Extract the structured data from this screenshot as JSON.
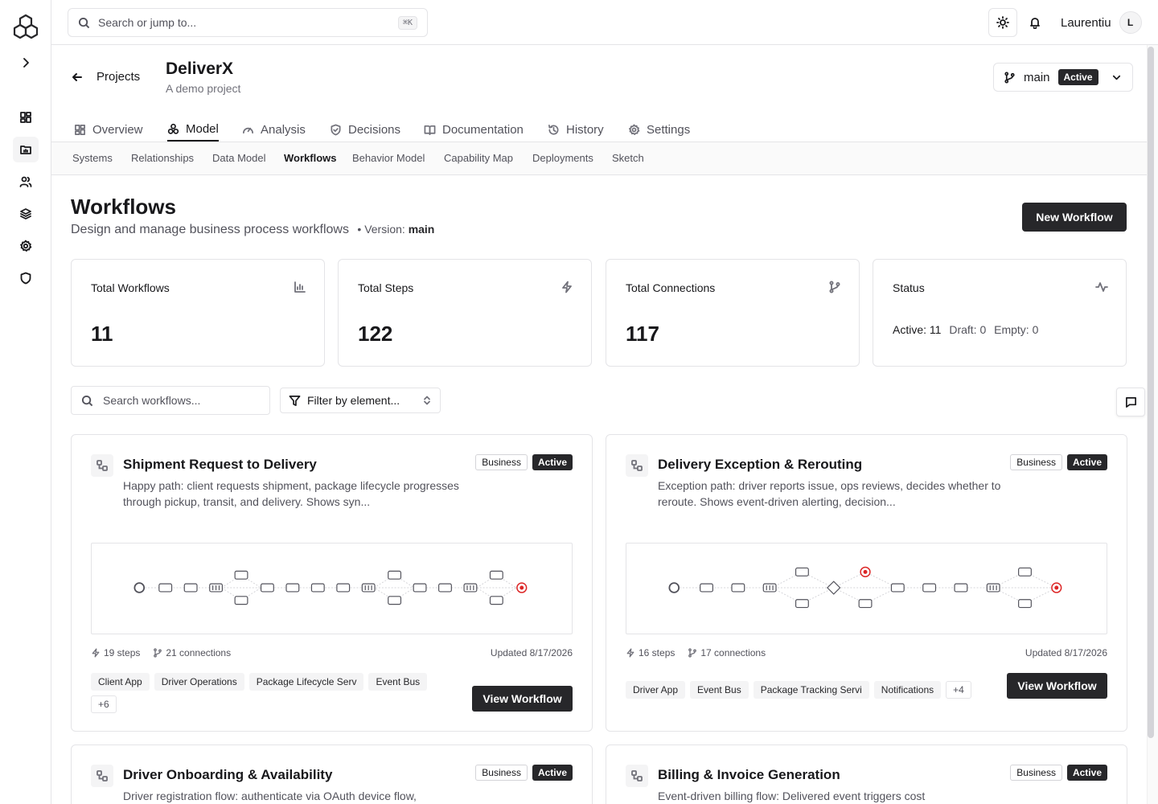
{
  "search": {
    "placeholder": "Search or jump to...",
    "shortcut": "⌘K"
  },
  "user": {
    "name": "Laurentiu",
    "initial": "L"
  },
  "project": {
    "back_label": "Projects",
    "name": "DeliverX",
    "description": "A demo project"
  },
  "branch": {
    "name": "main",
    "status": "Active"
  },
  "tabs": [
    {
      "label": "Overview",
      "icon": "grid-icon"
    },
    {
      "label": "Model",
      "icon": "model-icon",
      "active": true
    },
    {
      "label": "Analysis",
      "icon": "gauge-icon"
    },
    {
      "label": "Decisions",
      "icon": "shield-check-icon"
    },
    {
      "label": "Documentation",
      "icon": "book-icon"
    },
    {
      "label": "History",
      "icon": "history-icon"
    },
    {
      "label": "Settings",
      "icon": "gear-icon"
    }
  ],
  "subtabs": [
    {
      "label": "Systems"
    },
    {
      "label": "Relationships"
    },
    {
      "label": "Data Model"
    },
    {
      "label": "Workflows",
      "active": true
    },
    {
      "label": "Behavior Model"
    },
    {
      "label": "Capability Map"
    },
    {
      "label": "Deployments"
    },
    {
      "label": "Sketch"
    }
  ],
  "page": {
    "title": "Workflows",
    "subtitle": "Design and manage business process workflows",
    "version_prefix": "• Version:",
    "version": "main",
    "new_button": "New Workflow"
  },
  "stats": [
    {
      "label": "Total Workflows",
      "value": "11",
      "icon": "bar-chart-icon"
    },
    {
      "label": "Total Steps",
      "value": "122",
      "icon": "zap-icon"
    },
    {
      "label": "Total Connections",
      "value": "117",
      "icon": "git-branch-icon"
    },
    {
      "label": "Status",
      "icon": "activity-icon",
      "active": "Active: 11",
      "draft": "Draft: 0",
      "empty": "Empty: 0"
    }
  ],
  "filters": {
    "search_placeholder": "Search workflows...",
    "filter_label": "Filter by element..."
  },
  "workflows": [
    {
      "title": "Shipment Request to Delivery",
      "description": "Happy path: client requests shipment, package lifecycle progresses through pickup, transit, and delivery. Shows syn...",
      "type_badge": "Business",
      "status_badge": "Active",
      "steps": "19 steps",
      "connections": "21 connections",
      "updated": "Updated 8/17/2026",
      "chips": [
        "Client App",
        "Driver Operations",
        "Package Lifecycle Serv",
        "Event Bus"
      ],
      "more": "+6",
      "view_label": "View Workflow"
    },
    {
      "title": "Delivery Exception & Rerouting",
      "description": "Exception path: driver reports issue, ops reviews, decides whether to reroute. Shows event-driven alerting, decision...",
      "type_badge": "Business",
      "status_badge": "Active",
      "steps": "16 steps",
      "connections": "17 connections",
      "updated": "Updated 8/17/2026",
      "chips": [
        "Driver App",
        "Event Bus",
        "Package Tracking Servi",
        "Notifications"
      ],
      "more": "+4",
      "view_label": "View Workflow"
    },
    {
      "title": "Driver Onboarding & Availability",
      "description": "Driver registration flow: authenticate via OAuth device flow,",
      "type_badge": "Business",
      "status_badge": "Active"
    },
    {
      "title": "Billing & Invoice Generation",
      "description": "Event-driven billing flow: Delivered event triggers cost",
      "type_badge": "Business",
      "status_badge": "Active"
    }
  ],
  "colors": {
    "accent_dark": "#27272a",
    "end_node": "#dc2626",
    "border": "#e4e4e7"
  }
}
